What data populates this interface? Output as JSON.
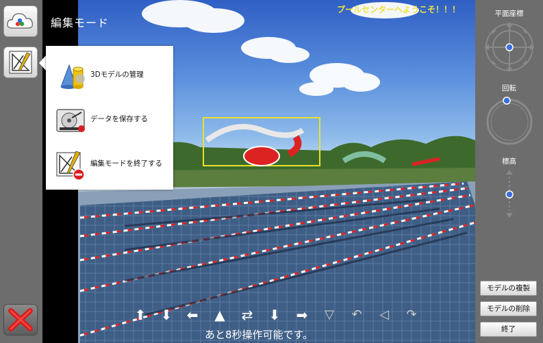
{
  "scene": {
    "mode_title": "編集モード",
    "welcome_text": "プールセンターへようこそ！！！",
    "countdown_text": "あと8秒操作可能です。"
  },
  "menu": {
    "items": [
      {
        "label": "3Dモデルの管理",
        "icon": "shapes-3d-icon"
      },
      {
        "label": "データを保存する",
        "icon": "hard-drive-save-icon"
      },
      {
        "label": "編集モードを終了する",
        "icon": "drafting-tools-exit-icon"
      }
    ]
  },
  "arrows": [
    "⬆",
    "⬇",
    "⬅",
    "▲",
    "⇄",
    "⬇",
    "➡",
    "▽",
    "↶",
    "◁",
    "↷"
  ],
  "right_panel": {
    "plane_coords_label": "平面座標",
    "rotation_label": "回転",
    "elevation_label": "標高",
    "duplicate_label": "モデルの複製",
    "delete_label": "モデルの削除",
    "end_label": "終了"
  },
  "colors": {
    "panel_bg": "#6d6d6d",
    "welcome_yellow": "#f0e23a",
    "close_red": "#d81e1e"
  }
}
